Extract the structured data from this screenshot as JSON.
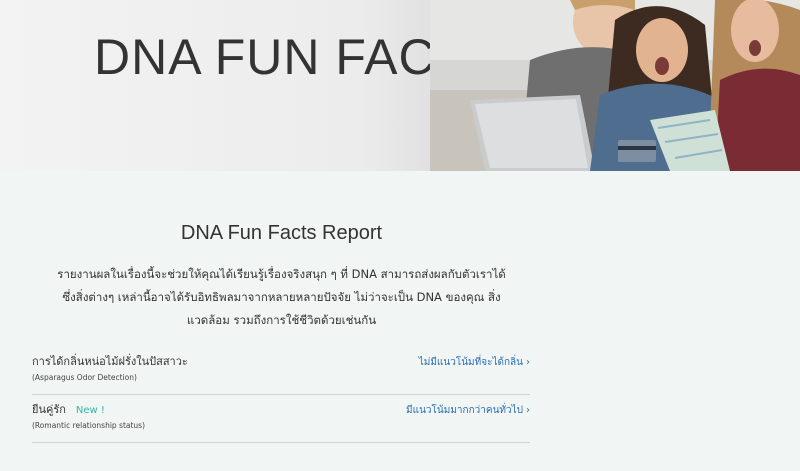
{
  "hero": {
    "title": "DNA FUN FACTS"
  },
  "report": {
    "title": "DNA Fun Facts Report",
    "intro": "รายงานผลในเรื่องนี้จะช่วยให้คุณได้เรียนรู้เรื่องจริงสนุก ๆ ที่ DNA สามารถส่งผลกับตัวเราได้ ซึ่งสิ่งต่างๆ เหล่านี้อาจได้รับอิทธิพลมาจากหลายหลายปัจจัย ไม่ว่าจะเป็น DNA ของคุณ สิ่งแวดล้อม รวมถึงการใช้ชีวิตด้วยเช่นกัน"
  },
  "facts": [
    {
      "name": "การได้กลิ่นหน่อไม้ฝรั่งในปัสสาวะ",
      "subtitle": "(Asparagus Odor Detection)",
      "badge": "",
      "result": "ไม่มีแนวโน้มที่จะได้กลิ่น"
    },
    {
      "name": "ยีนคู่รัก",
      "subtitle": "(Romantic relationship status)",
      "badge": "New !",
      "result": "มีแนวโน้มมากกว่าคนทั่วไป"
    }
  ],
  "icons": {
    "chevron": "chevron-right-icon"
  },
  "colors": {
    "link": "#2a6fb5",
    "badge": "#36b6a8",
    "background": "#f1f5f4"
  }
}
